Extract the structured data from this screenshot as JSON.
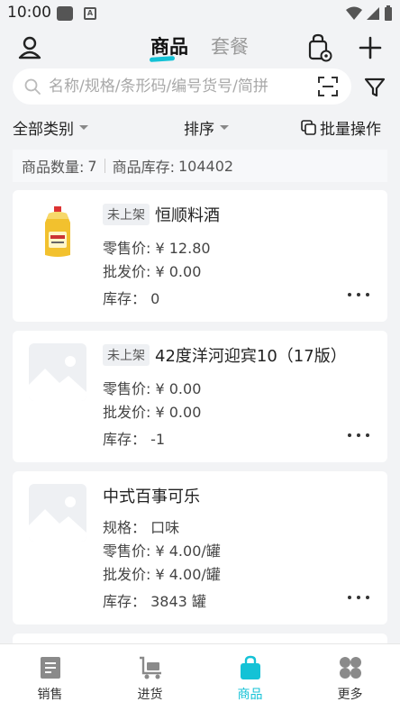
{
  "status_bar": {
    "time": "10:00"
  },
  "header": {
    "tabs": [
      {
        "label": "商品",
        "active": true
      },
      {
        "label": "套餐",
        "active": false
      }
    ],
    "icons": [
      "user-icon",
      "bag-settings-icon",
      "plus-icon"
    ],
    "accent_color": "#14c2d6"
  },
  "search": {
    "placeholder": "名称/规格/条形码/编号货号/简拼",
    "value": ""
  },
  "toolbar": {
    "category": "全部类别",
    "sort": "排序",
    "batch": "批量操作"
  },
  "summary": {
    "count_label": "商品数量:",
    "count": "7",
    "stock_label": "商品库存:",
    "stock": "104402"
  },
  "products": [
    {
      "tag": "未上架",
      "name": "恒顺料酒",
      "lines": [
        "零售价: ¥ 12.80",
        "批发价: ¥ 0.00",
        "库存： 0"
      ],
      "image": "yellow-bottle"
    },
    {
      "tag": "未上架",
      "name": "42度洋河迎宾10（17版）",
      "lines": [
        "零售价: ¥ 0.00",
        "批发价: ¥ 0.00",
        "库存： -1"
      ],
      "image": "placeholder"
    },
    {
      "tag": "",
      "name": "中式百事可乐",
      "lines": [
        "规格： 口味",
        "零售价: ¥ 4.00/罐",
        "批发价: ¥ 4.00/罐",
        "库存： 3843 罐"
      ],
      "image": "placeholder"
    }
  ],
  "tabbar": {
    "items": [
      {
        "label": "销售",
        "icon": "sales-icon",
        "active": false
      },
      {
        "label": "进货",
        "icon": "purchase-cart-icon",
        "active": false
      },
      {
        "label": "商品",
        "icon": "goods-bag-icon",
        "active": true
      },
      {
        "label": "更多",
        "icon": "more-clover-icon",
        "active": false
      }
    ]
  }
}
